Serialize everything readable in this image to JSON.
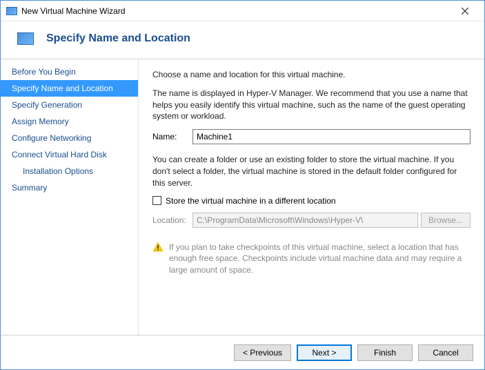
{
  "window": {
    "title": "New Virtual Machine Wizard"
  },
  "header": {
    "title": "Specify Name and Location"
  },
  "sidebar": {
    "items": [
      {
        "label": "Before You Begin",
        "selected": false
      },
      {
        "label": "Specify Name and Location",
        "selected": true
      },
      {
        "label": "Specify Generation",
        "selected": false
      },
      {
        "label": "Assign Memory",
        "selected": false
      },
      {
        "label": "Configure Networking",
        "selected": false
      },
      {
        "label": "Connect Virtual Hard Disk",
        "selected": false
      },
      {
        "label": "Installation Options",
        "selected": false,
        "sub": true
      },
      {
        "label": "Summary",
        "selected": false
      }
    ]
  },
  "main": {
    "intro": "Choose a name and location for this virtual machine.",
    "desc": "The name is displayed in Hyper-V Manager. We recommend that you use a name that helps you easily identify this virtual machine, such as the name of the guest operating system or workload.",
    "name_label": "Name:",
    "name_value": "Machine1",
    "folder_desc": "You can create a folder or use an existing folder to store the virtual machine. If you don't select a folder, the virtual machine is stored in the default folder configured for this server.",
    "checkbox_label": "Store the virtual machine in a different location",
    "checkbox_checked": false,
    "location_label": "Location:",
    "location_value": "C:\\ProgramData\\Microsoft\\Windows\\Hyper-V\\",
    "browse_label": "Browse...",
    "warning_text": "If you plan to take checkpoints of this virtual machine, select a location that has enough free space. Checkpoints include virtual machine data and may require a large amount of space."
  },
  "buttons": {
    "previous": "< Previous",
    "next": "Next >",
    "finish": "Finish",
    "cancel": "Cancel"
  }
}
